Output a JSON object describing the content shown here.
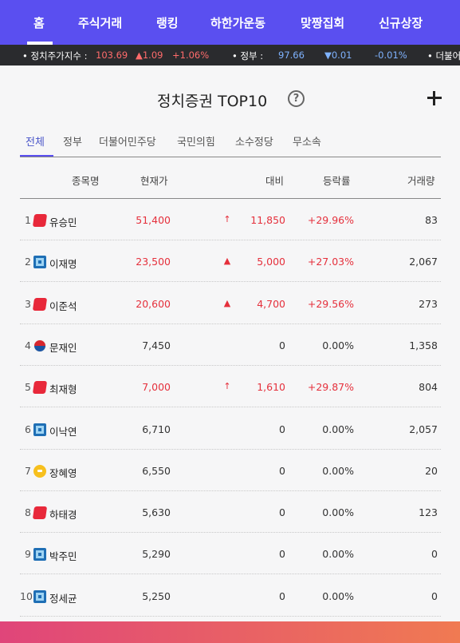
{
  "nav": {
    "items": [
      "홈",
      "주식거래",
      "랭킹",
      "하한가운동",
      "맞짱집회",
      "신규상장"
    ]
  },
  "ticker": {
    "item1_label": "• 정치주가지수 :",
    "item1_value": "103.69",
    "item1_change": "▲1.09",
    "item1_pct": "+1.06%",
    "item2_label": "• 정부 :",
    "item2_value": "97.66",
    "item2_change": "▼0.01",
    "item2_pct": "-0.01%",
    "item3_label": "• 더불어"
  },
  "page": {
    "title": "정치증권 TOP10",
    "help": "?"
  },
  "tabs": [
    "전체",
    "정부",
    "더불어민주당",
    "국민의힘",
    "소수정당",
    "무소속"
  ],
  "table": {
    "headers": {
      "name": "종목명",
      "price": "현재가",
      "change": "대비",
      "pct": "등락률",
      "volume": "거래량"
    },
    "rows": [
      {
        "rank": "1",
        "icon": "red-party-icon",
        "name": "유승민",
        "price": "51,400",
        "arrow": "↑",
        "change": "11,850",
        "pct": "+29.96%",
        "volume": "83",
        "up": true
      },
      {
        "rank": "2",
        "icon": "blue-party-icon",
        "name": "이재명",
        "price": "23,500",
        "arrow": "▲",
        "change": "5,000",
        "pct": "+27.03%",
        "volume": "2,067",
        "up": true
      },
      {
        "rank": "3",
        "icon": "red-party-icon",
        "name": "이준석",
        "price": "20,600",
        "arrow": "▲",
        "change": "4,700",
        "pct": "+29.56%",
        "volume": "273",
        "up": true
      },
      {
        "rank": "4",
        "icon": "taeguk-icon",
        "name": "문재인",
        "price": "7,450",
        "arrow": "",
        "change": "0",
        "pct": "0.00%",
        "volume": "1,358",
        "up": false
      },
      {
        "rank": "5",
        "icon": "red-party-icon",
        "name": "최재형",
        "price": "7,000",
        "arrow": "↑",
        "change": "1,610",
        "pct": "+29.87%",
        "volume": "804",
        "up": true
      },
      {
        "rank": "6",
        "icon": "blue-party-icon",
        "name": "이낙연",
        "price": "6,710",
        "arrow": "",
        "change": "0",
        "pct": "0.00%",
        "volume": "2,057",
        "up": false
      },
      {
        "rank": "7",
        "icon": "yellow-party-icon",
        "name": "장혜영",
        "price": "6,550",
        "arrow": "",
        "change": "0",
        "pct": "0.00%",
        "volume": "20",
        "up": false
      },
      {
        "rank": "8",
        "icon": "red-party-icon",
        "name": "하태경",
        "price": "5,630",
        "arrow": "",
        "change": "0",
        "pct": "0.00%",
        "volume": "123",
        "up": false
      },
      {
        "rank": "9",
        "icon": "blue-party-icon",
        "name": "박주민",
        "price": "5,290",
        "arrow": "",
        "change": "0",
        "pct": "0.00%",
        "volume": "0",
        "up": false
      },
      {
        "rank": "10",
        "icon": "blue-party-icon",
        "name": "정세균",
        "price": "5,250",
        "arrow": "",
        "change": "0",
        "pct": "0.00%",
        "volume": "0",
        "up": false
      }
    ]
  },
  "colors": {
    "nav_bg": "#5a4ff0",
    "up": "#e5303c",
    "ticker_bg": "#2a2b2e"
  }
}
